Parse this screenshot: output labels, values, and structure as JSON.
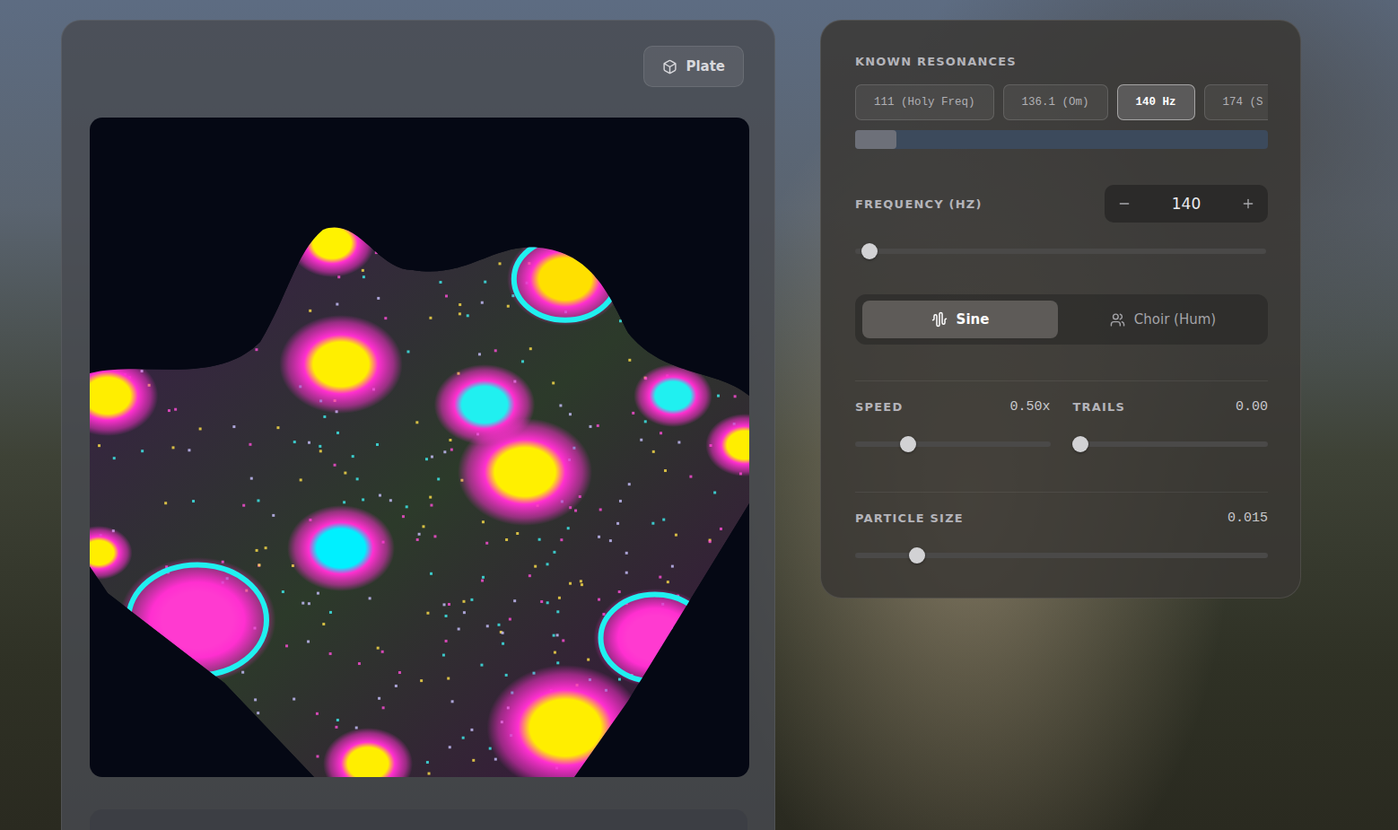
{
  "plate_button": {
    "label": "Plate"
  },
  "resonances": {
    "title": "KNOWN RESONANCES",
    "items": [
      {
        "label": "111 (Holy Freq)",
        "selected": false
      },
      {
        "label": "136.1 (Om)",
        "selected": false
      },
      {
        "label": "140 Hz",
        "selected": true
      },
      {
        "label": "174 (S",
        "selected": false
      }
    ],
    "scroll": {
      "level": 0.1
    }
  },
  "frequency": {
    "label": "FREQUENCY (HZ)",
    "value": "140",
    "level": 0.035
  },
  "waveforms": [
    {
      "label": "Sine",
      "selected": true,
      "kind": "sine"
    },
    {
      "label": "Choir (Hum)",
      "selected": false,
      "kind": "choir"
    }
  ],
  "speed": {
    "label": "SPEED",
    "reading": "0.50x",
    "level": 0.27
  },
  "trails": {
    "label": "TRAILS",
    "reading": "0.00",
    "level": 0.04
  },
  "particle_size": {
    "label": "PARTICLE SIZE",
    "reading": "0.015",
    "level": 0.15
  }
}
